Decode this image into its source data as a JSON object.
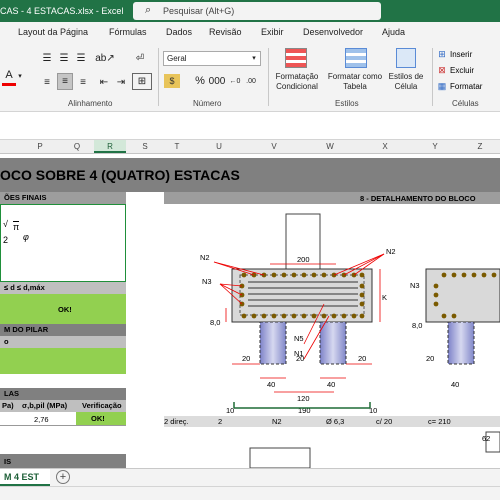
{
  "window": {
    "title": "CAS - 4 ESTACAS.xlsx  -  Excel"
  },
  "search": {
    "placeholder": "Pesquisar (Alt+G)"
  },
  "menu": [
    "Layout da Página",
    "Fórmulas",
    "Dados",
    "Revisão",
    "Exibir",
    "Desenvolvedor",
    "Ajuda"
  ],
  "ribbon": {
    "number_format": "Geral",
    "format_table_label": "Formatação\nCondicional",
    "format_as_table_label": "Formatar como\nTabela",
    "cell_styles_label": "Estilos de\nCélula",
    "insert_label": "Inserir",
    "delete_label": "Excluir",
    "format_label": "Formatar",
    "groups": {
      "alignment": "Alinhamento",
      "number": "Número",
      "styles": "Estilos",
      "cells": "Células"
    }
  },
  "columns": [
    "P",
    "Q",
    "R",
    "S",
    "T",
    "U",
    "V",
    "W",
    "X",
    "Y",
    "Z"
  ],
  "selected_column": "R",
  "sheet": {
    "banner": "OCO SOBRE 4 (QUATRO) ESTACAS",
    "sections": {
      "final": "ÕES FINAIS",
      "detail": "8 - DETALHAMENTO DO BLOCO",
      "pillar": "M DO PILAR",
      "tension": "LAS"
    },
    "range_text": "≤ d ≤ d,máx",
    "ok1": "OK!",
    "pillar_sub": "o",
    "tension_headers": [
      "Pa)",
      "σ,b,pil (MPa)",
      "Verificação"
    ],
    "tension_values": [
      "2,76",
      "OK!"
    ],
    "bottom_label": "IS",
    "formula_fragment": "π",
    "formula_sub": "φ",
    "formula_two": "2"
  },
  "drawing": {
    "labels": {
      "n1": "N1",
      "n2": "N2",
      "n3": "N3",
      "n5": "N5",
      "dim200": "200",
      "dim120": "120",
      "dim40a": "40",
      "dim40b": "40",
      "dim20a": "20",
      "dim20b": "20",
      "dim20c": "20",
      "dim80": "8,0",
      "dimK": "K",
      "dim190": "190",
      "dim10a": "10",
      "dim10b": "10",
      "n2b": "N2",
      "n3b": "N3",
      "dim20d": "20",
      "dim80b": "8,0",
      "dim40c": "40"
    }
  },
  "bar_table": {
    "cells": [
      "2 direç.",
      "2",
      "N2",
      "Ø 6,3",
      "c/ 20",
      "c= 210"
    ],
    "side": "62"
  },
  "tabs": {
    "sheet_name": "M 4 EST",
    "add_symbol": "+"
  }
}
